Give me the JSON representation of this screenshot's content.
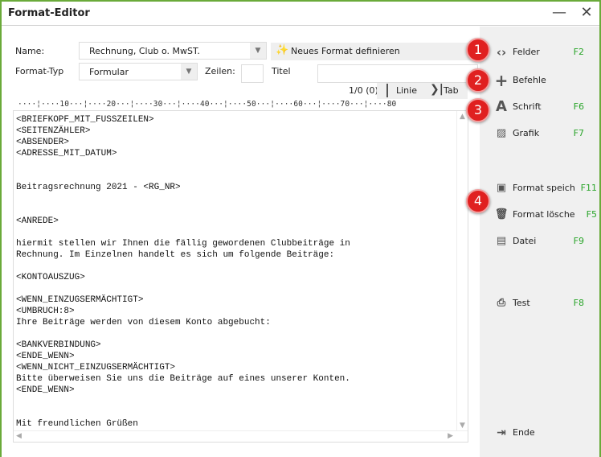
{
  "window": {
    "title": "Format-Editor",
    "minimize": "—",
    "close": "✕"
  },
  "form": {
    "name_label": "Name:",
    "name_value": "Rechnung, Club o. MwST.",
    "new_format": "Neues Format definieren",
    "type_label": "Format-Typ",
    "type_value": "Formular",
    "rows_label": "Zeilen:",
    "rows_value": "",
    "title_label": "Titel",
    "title_value": "",
    "position": "1/0 (0)",
    "line_btn": "Linie",
    "tab_btn": "Tab"
  },
  "ruler": "····¦····10···¦····20···¦····30···¦····40···¦····50···¦····60···¦····70···¦····80",
  "editor": {
    "lines": [
      "<BRIEFKOPF_MIT_FUSSZEILEN>",
      "<SEITENZÄHLER>",
      "<ABSENDER>",
      "<ADRESSE_MIT_DATUM>",
      "",
      "",
      "Beitragsrechnung 2021 - <RG_NR>",
      "",
      "",
      "<ANREDE>",
      "",
      "hiermit stellen wir Ihnen die fällig gewordenen Clubbeiträge in",
      "Rechnung. Im Einzelnen handelt es sich um folgende Beiträge:",
      "",
      "<KONTOAUSZUG>",
      "",
      "<WENN_EINZUGSERMÄCHTIGT>",
      "<UMBRUCH:8>",
      "Ihre Beiträge werden von diesem Konto abgebucht:",
      "",
      "<BANKVERBINDUNG>",
      "<ENDE_WENN>",
      "<WENN_NICHT_EINZUGSERMÄCHTIGT>",
      "Bitte überweisen Sie uns die Beiträge auf eines unserer Konten.",
      "<ENDE_WENN>",
      "",
      "",
      "Mit freundlichen Grüßen"
    ]
  },
  "badges": [
    "1",
    "2",
    "3",
    "4"
  ],
  "sidebar": [
    {
      "label": "Felder",
      "key": "F2",
      "icon": "code-icon"
    },
    {
      "label": "Befehle",
      "key": "",
      "icon": "plus-icon"
    },
    {
      "label": "Schrift",
      "key": "F6",
      "icon": "font-icon"
    },
    {
      "label": "Grafik",
      "key": "F7",
      "icon": "image-icon"
    },
    {
      "label": "Format speich",
      "key": "F11",
      "icon": "save-icon"
    },
    {
      "label": "Format lösche",
      "key": "F5",
      "icon": "trash-icon"
    },
    {
      "label": "Datei",
      "key": "F9",
      "icon": "folder-search-icon"
    },
    {
      "label": "Test",
      "key": "F8",
      "icon": "printer-icon"
    },
    {
      "label": "Ende",
      "key": "",
      "icon": "exit-icon"
    }
  ],
  "colors": {
    "accent": "#6aaa3a",
    "hotkey": "#2aa52a",
    "badge": "#e02020"
  }
}
